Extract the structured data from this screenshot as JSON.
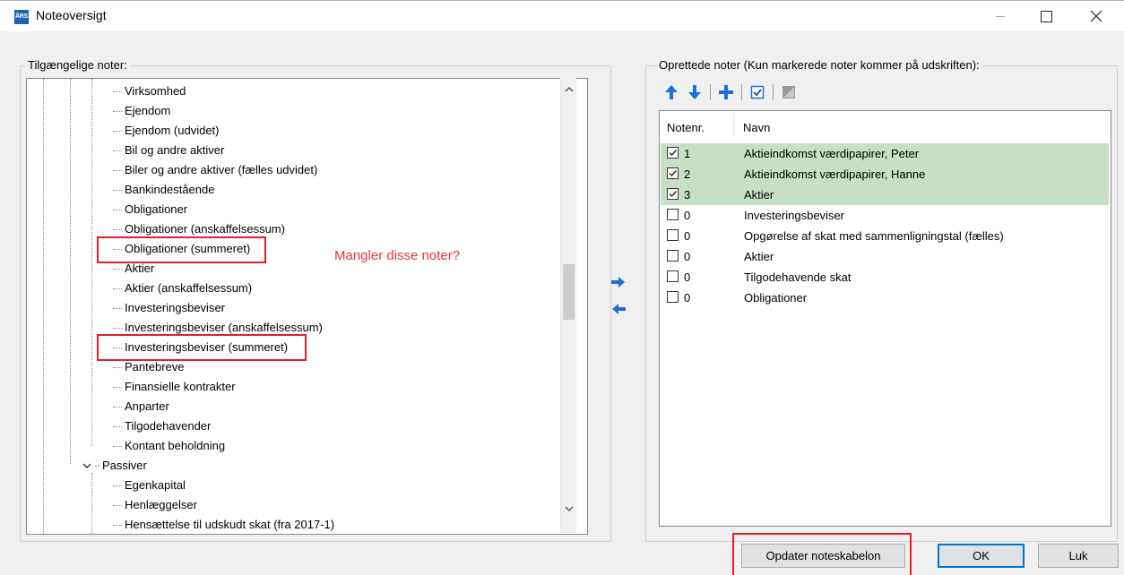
{
  "window": {
    "title": "Noteoversigt",
    "icon_text": "ÅRS",
    "icon_color": "#1f5fb5"
  },
  "left_panel": {
    "label": "Tilgængelige noter:",
    "items": [
      "Virksomhed",
      "Ejendom",
      "Ejendom (udvidet)",
      "Bil og andre aktiver",
      "Biler og andre aktiver (fælles udvidet)",
      "Bankindestående",
      "Obligationer",
      "Obligationer (anskaffelsessum)",
      "Obligationer (summeret)",
      "Aktier",
      "Aktier (anskaffelsessum)",
      "Investeringsbeviser",
      "Investeringsbeviser (anskaffelsessum)",
      "Investeringsbeviser (summeret)",
      "Pantebreve",
      "Finansielle kontrakter",
      "Anparter",
      "Tilgodehavender",
      "Kontant beholdning"
    ],
    "group2_label": "Passiver",
    "group2_items": [
      "Egenkapital",
      "Henlæggelser",
      "Hensættelse til udskudt skat (fra 2017-1)"
    ]
  },
  "annotation": {
    "text": "Mangler disse noter?",
    "color": "#e8343a"
  },
  "right_panel": {
    "label": "Oprettede noter (Kun markerede noter kommer på udskriften):",
    "columns": [
      "Notenr.",
      "Navn"
    ],
    "rows": [
      {
        "checked": true,
        "num": "1",
        "name": "Aktieindkomst værdipapirer, Peter"
      },
      {
        "checked": true,
        "num": "2",
        "name": "Aktieindkomst værdipapirer, Hanne"
      },
      {
        "checked": true,
        "num": "3",
        "name": "Aktier"
      },
      {
        "checked": false,
        "num": "0",
        "name": "Investeringsbeviser"
      },
      {
        "checked": false,
        "num": "0",
        "name": "Opgørelse af skat med sammenligningstal (fælles)"
      },
      {
        "checked": false,
        "num": "0",
        "name": "Aktier"
      },
      {
        "checked": false,
        "num": "0",
        "name": "Tilgodehavende skat"
      },
      {
        "checked": false,
        "num": "0",
        "name": "Obligationer"
      }
    ],
    "checked_row_color": "#c6dfc6"
  },
  "buttons": {
    "update": "Opdater noteskabelon",
    "ok": "OK",
    "close": "Luk"
  },
  "colors": {
    "accent": "#1e6fd9",
    "highlight_red": "#e0202a"
  }
}
